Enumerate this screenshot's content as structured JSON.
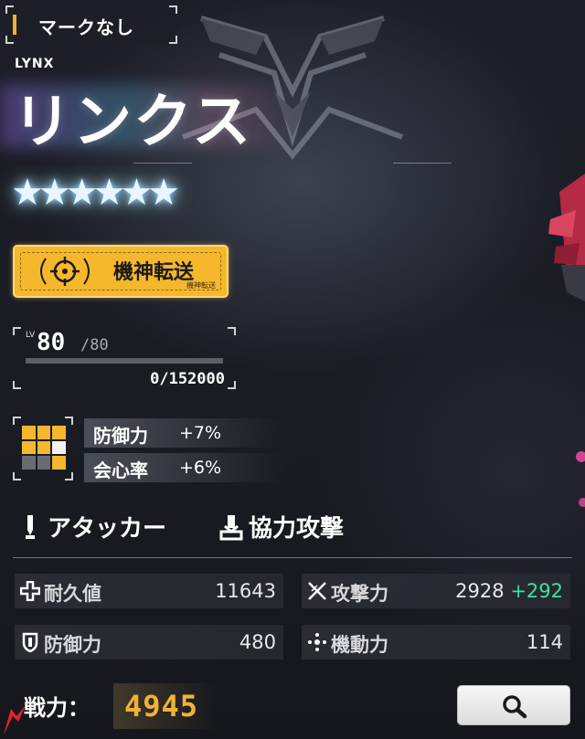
{
  "mark": {
    "label": "マークなし"
  },
  "unit": {
    "name_en": "LYNX",
    "name_jp": "リンクス",
    "stars": "★★★★★★"
  },
  "transfer": {
    "label": "機神転送",
    "sub_label": "機神転送"
  },
  "level": {
    "prefix": "LV",
    "current": "80",
    "max": "/80",
    "exp": "0/152000",
    "exp_progress": 0
  },
  "bonuses": [
    {
      "label": "防御力",
      "value": "+7%"
    },
    {
      "label": "会心率",
      "value": "+6%"
    }
  ],
  "roles": [
    {
      "label": "アタッカー",
      "icon": "attacker-icon"
    },
    {
      "label": "協力攻撃",
      "icon": "coop-attack-icon"
    }
  ],
  "stats": {
    "hp": {
      "label": "耐久値",
      "value": "11643",
      "icon": "cross-icon"
    },
    "attack": {
      "label": "攻撃力",
      "value": "2928",
      "bonus": "+292",
      "icon": "crossed-swords-icon"
    },
    "defense": {
      "label": "防御力",
      "value": "480",
      "icon": "shield-icon"
    },
    "mobility": {
      "label": "機動力",
      "value": "114",
      "icon": "mobility-icon"
    }
  },
  "power": {
    "label": "戦力：",
    "value": "4945"
  },
  "search": {
    "icon": "magnifier-icon"
  },
  "colors": {
    "accent": "#f1b233",
    "bonus_green": "#3fe0a0"
  }
}
